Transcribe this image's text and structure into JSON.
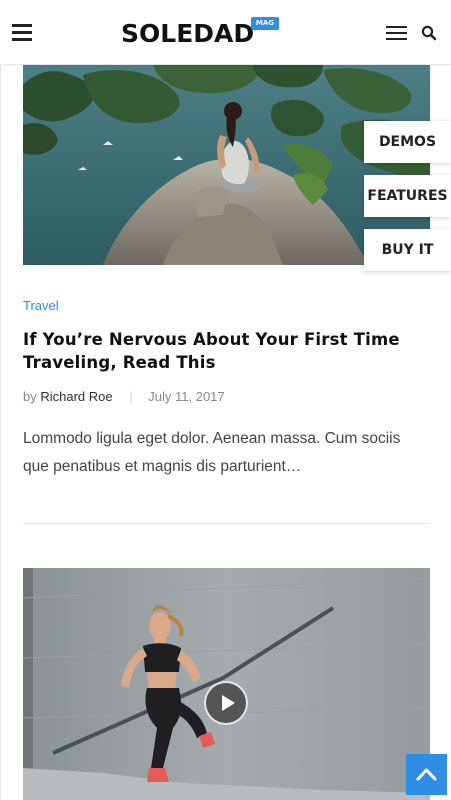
{
  "header": {
    "logo_text": "SOLEDAD",
    "logo_badge": "MAG",
    "accent_color": "#2f8ee3"
  },
  "side_buttons": {
    "demos": "DEMOS",
    "features": "FEATURES",
    "buy_it": "BUY IT"
  },
  "post": {
    "category": "Travel",
    "title": "If You’re Nervous About Your First Time Traveling, Read This",
    "by": "by",
    "author": "Richard Roe",
    "separator": "|",
    "date": "July 11, 2017",
    "excerpt": "Lommodo ligula eget dolor. Aenean massa. Cum sociis que penatibus et magnis dis parturient…"
  },
  "icons": {
    "menu": "hamburger-icon",
    "nav": "menu-lines-icon",
    "search": "search-icon",
    "play": "play-icon",
    "scroll_top": "chevron-up-icon"
  }
}
